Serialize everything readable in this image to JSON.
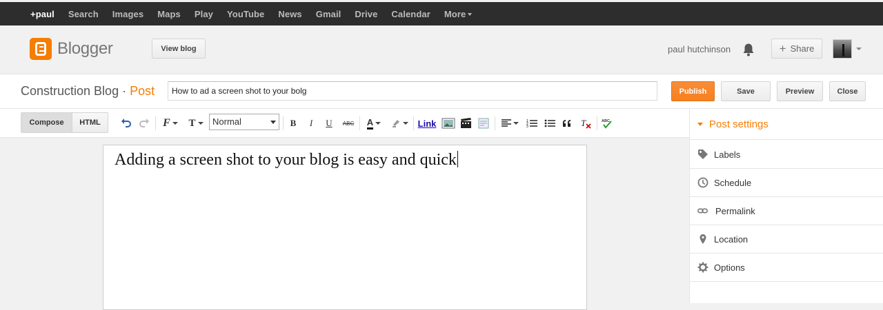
{
  "gbar": {
    "items": [
      "+paul",
      "Search",
      "Images",
      "Maps",
      "Play",
      "YouTube",
      "News",
      "Gmail",
      "Drive",
      "Calendar",
      "More"
    ]
  },
  "header": {
    "brand": "Blogger",
    "view_blog": "View blog",
    "username": "paul hutchinson",
    "share": "Share"
  },
  "post": {
    "blog_name": "Construction Blog",
    "separator": "·",
    "section": "Post",
    "title_value": "How to ad a screen shot to your bolg",
    "publish": "Publish",
    "save": "Save",
    "preview": "Preview",
    "close": "Close"
  },
  "toolbar": {
    "compose": "Compose",
    "html": "HTML",
    "format": "Normal",
    "bold": "B",
    "italic": "I",
    "underline": "U",
    "strike": "ABC",
    "text_color": "A",
    "link": "Link"
  },
  "editor": {
    "body": "Adding a screen shot to your blog is easy and quick"
  },
  "sidebar": {
    "heading": "Post settings",
    "items": [
      {
        "label": "Labels",
        "icon": "tag-icon"
      },
      {
        "label": "Schedule",
        "icon": "clock-icon"
      },
      {
        "label": "Permalink",
        "icon": "link-icon"
      },
      {
        "label": "Location",
        "icon": "location-pin-icon"
      },
      {
        "label": "Options",
        "icon": "gear-icon"
      }
    ]
  },
  "colors": {
    "accent": "#f57d00",
    "gbar": "#2d2d2d",
    "link": "#1a0dab"
  }
}
